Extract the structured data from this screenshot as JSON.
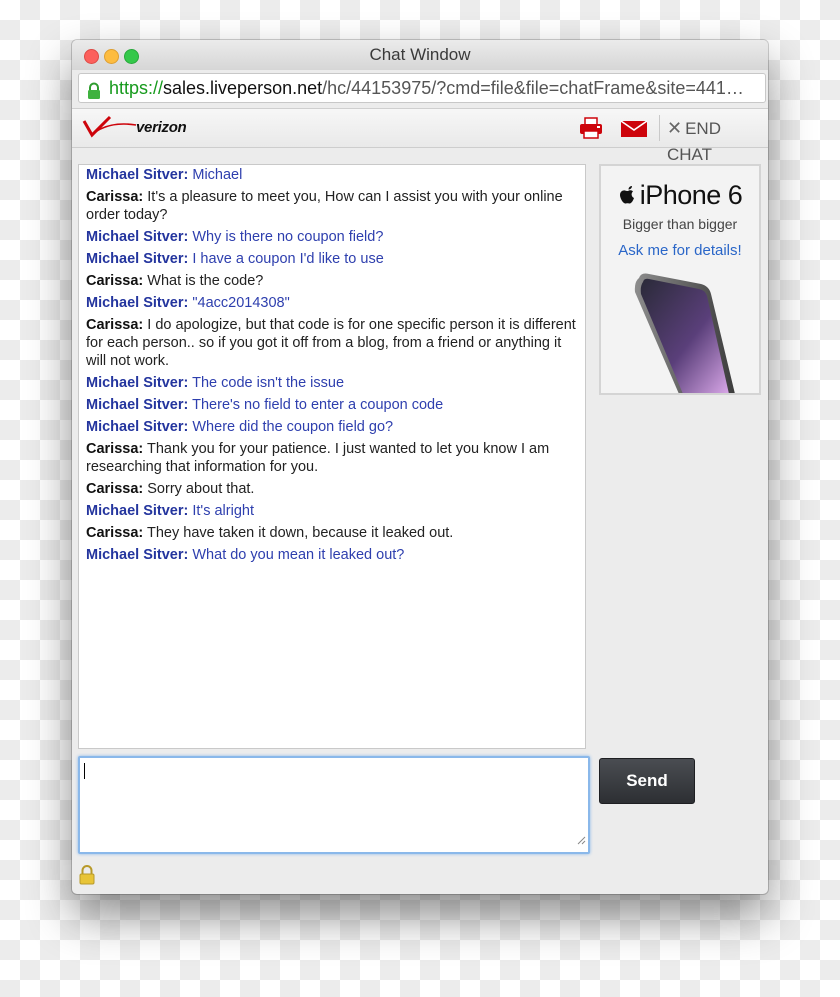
{
  "window": {
    "title": "Chat Window"
  },
  "address_bar": {
    "scheme": "https://",
    "host": "sales.liveperson.net",
    "path": "/hc/44153975/?cmd=file&file=chatFrame&site=441…"
  },
  "toolbar": {
    "brand": "verizon",
    "end_chat_label": "END CHAT",
    "icons": [
      "printer-icon",
      "email-icon",
      "close-x-icon"
    ]
  },
  "transcript": [
    {
      "sender": "Michael Sitver:",
      "text": "Michael",
      "role": "customer"
    },
    {
      "sender": "Carissa:",
      "text": "It's a pleasure to meet you, How can I assist you with your online order today?",
      "role": "agent"
    },
    {
      "sender": "Michael Sitver:",
      "text": "Why is there no coupon field?",
      "role": "customer"
    },
    {
      "sender": "Michael Sitver:",
      "text": "I have a coupon I'd like to use",
      "role": "customer"
    },
    {
      "sender": "Carissa:",
      "text": "What is the code?",
      "role": "agent"
    },
    {
      "sender": "Michael Sitver:",
      "text": "\"4acc2014308\"",
      "role": "customer"
    },
    {
      "sender": "Carissa:",
      "text": "I do apologize, but that code is for one specific person it is different for each person.. so if you got it off from a blog, from a friend or anything it will not work.",
      "role": "agent"
    },
    {
      "sender": "Michael Sitver:",
      "text": "The code isn't the issue",
      "role": "customer"
    },
    {
      "sender": "Michael Sitver:",
      "text": "There's no field to enter a coupon code",
      "role": "customer"
    },
    {
      "sender": "Michael Sitver:",
      "text": "Where did the coupon field go?",
      "role": "customer"
    },
    {
      "sender": "Carissa:",
      "text": "Thank you for your patience. I just wanted to let you know I am researching that information for you.",
      "role": "agent"
    },
    {
      "sender": "Carissa:",
      "text": "Sorry about that.",
      "role": "agent"
    },
    {
      "sender": "Michael Sitver:",
      "text": "It's alright",
      "role": "customer"
    },
    {
      "sender": "Carissa:",
      "text": "They have taken it down, because it leaked out.",
      "role": "agent"
    },
    {
      "sender": "Michael Sitver:",
      "text": "What do you mean it leaked out?",
      "role": "customer"
    }
  ],
  "ad": {
    "title": "iPhone 6",
    "subtitle": "Bigger than bigger",
    "cta": "Ask me for details!"
  },
  "composer": {
    "value": "",
    "send_label": "Send"
  },
  "colors": {
    "customer_text": "#2e3fae",
    "agent_text": "#222222",
    "brand_red": "#cd040b",
    "url_green": "#169a1c",
    "send_button": "#3a3c40"
  }
}
